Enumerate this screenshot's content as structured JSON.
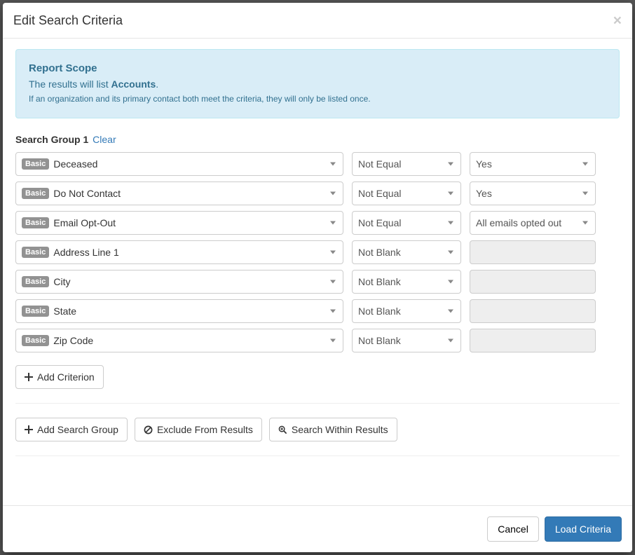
{
  "header": {
    "title": "Edit Search Criteria"
  },
  "scope": {
    "title": "Report Scope",
    "line1_prefix": "The results will list ",
    "line1_bold": "Accounts",
    "line1_suffix": ".",
    "line2": "If an organization and its primary contact both meet the criteria, they will only be listed once."
  },
  "group": {
    "label": "Search Group 1",
    "clear": "Clear"
  },
  "tag": {
    "basic": "Basic"
  },
  "criteria": [
    {
      "field": "Deceased",
      "op": "Not Equal",
      "val": "Yes",
      "val_enabled": true
    },
    {
      "field": "Do Not Contact",
      "op": "Not Equal",
      "val": "Yes",
      "val_enabled": true
    },
    {
      "field": "Email Opt-Out",
      "op": "Not Equal",
      "val": "All emails opted out",
      "val_enabled": true
    },
    {
      "field": "Address Line 1",
      "op": "Not Blank",
      "val": "",
      "val_enabled": false
    },
    {
      "field": "City",
      "op": "Not Blank",
      "val": "",
      "val_enabled": false
    },
    {
      "field": "State",
      "op": "Not Blank",
      "val": "",
      "val_enabled": false
    },
    {
      "field": "Zip Code",
      "op": "Not Blank",
      "val": "",
      "val_enabled": false
    }
  ],
  "buttons": {
    "add_criterion": "Add Criterion",
    "add_group": "Add Search Group",
    "exclude": "Exclude From Results",
    "within": "Search Within Results",
    "cancel": "Cancel",
    "load": "Load Criteria"
  }
}
